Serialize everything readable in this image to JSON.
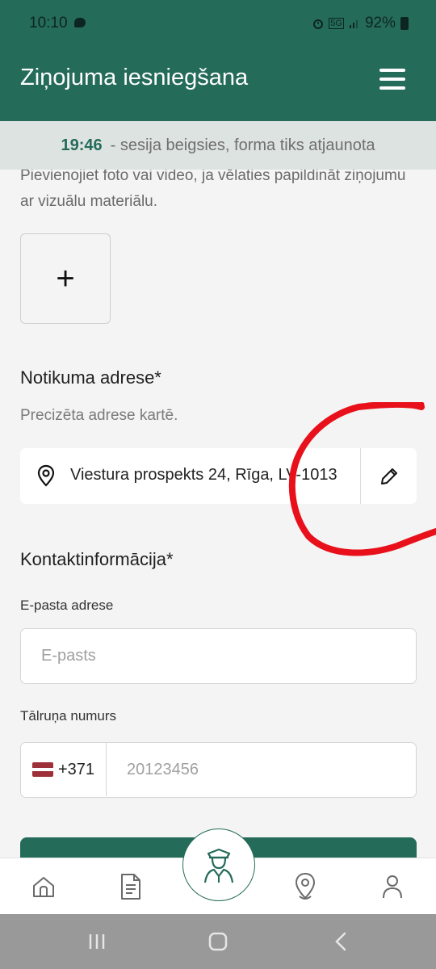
{
  "status_bar": {
    "time": "10:10",
    "network": "5G",
    "battery": "92%"
  },
  "app_bar": {
    "title": "Ziņojuma iesniegšana",
    "menu_icon": "hamburger-icon"
  },
  "session_banner": {
    "timer": "19:46",
    "text": "- sesija beigsies, forma tiks atjaunota"
  },
  "media_section": {
    "description": "Pievienojiet foto vai video, ja vēlaties papildināt ziņojumu ar vizuālu materiālu.",
    "add_label": "+"
  },
  "address_section": {
    "title": "Notikuma adrese*",
    "subtitle": "Precizēta adrese kartē.",
    "value": "Viestura prospekts 24, Rīga, LV-1013",
    "pin_icon": "location-pin-icon",
    "edit_icon": "pencil-icon"
  },
  "contact_section": {
    "title": "Kontaktinformācija*",
    "email_label": "E-pasta adrese",
    "email_placeholder": "E-pasts",
    "phone_label": "Tālruņa numurs",
    "country_code": "+371",
    "phone_placeholder": "20123456"
  },
  "bottom_nav": {
    "items": [
      "home-icon",
      "document-icon",
      "police-officer-icon",
      "location-pin-icon",
      "profile-icon"
    ],
    "accent": "#256b5a"
  },
  "annotation": {
    "color": "#e8101a"
  }
}
